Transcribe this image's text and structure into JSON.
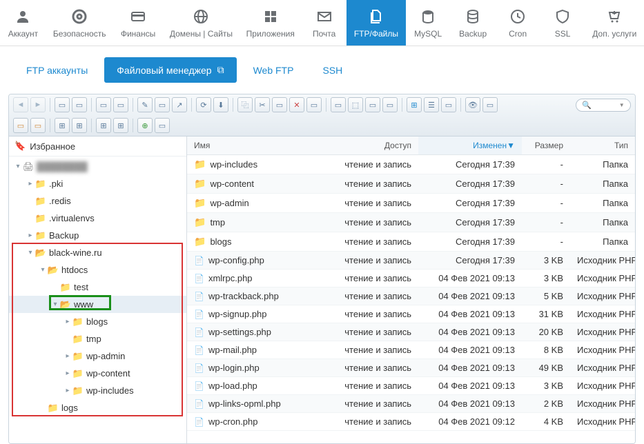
{
  "topnav": [
    {
      "label": "Аккаунт",
      "icon": "user"
    },
    {
      "label": "Безопасность",
      "icon": "lifebuoy"
    },
    {
      "label": "Финансы",
      "icon": "card"
    },
    {
      "label": "Домены | Сайты",
      "icon": "globe"
    },
    {
      "label": "Приложения",
      "icon": "apps"
    },
    {
      "label": "Почта",
      "icon": "mail"
    },
    {
      "label": "FTP/Файлы",
      "icon": "files",
      "active": true
    },
    {
      "label": "MySQL",
      "icon": "database"
    },
    {
      "label": "Backup",
      "icon": "backup"
    },
    {
      "label": "Cron",
      "icon": "clock"
    },
    {
      "label": "SSL",
      "icon": "shield"
    },
    {
      "label": "Доп. услуги",
      "icon": "cart"
    }
  ],
  "subnav": [
    {
      "label": "FTP аккаунты"
    },
    {
      "label": "Файловый менеджер",
      "active": true,
      "ext_icon": true
    },
    {
      "label": "Web FTP"
    },
    {
      "label": "SSH"
    }
  ],
  "favorites_label": "Избранное",
  "tree": [
    {
      "label": "",
      "depth": 0,
      "expander": "▾",
      "icon": "printer",
      "blur": true
    },
    {
      "label": ".pki",
      "depth": 1,
      "expander": "▸",
      "icon": "folder"
    },
    {
      "label": ".redis",
      "depth": 1,
      "expander": "",
      "icon": "folder"
    },
    {
      "label": ".virtualenvs",
      "depth": 1,
      "expander": "",
      "icon": "folder"
    },
    {
      "label": "Backup",
      "depth": 1,
      "expander": "▸",
      "icon": "folder"
    },
    {
      "label": "black-wine.ru",
      "depth": 1,
      "expander": "▾",
      "icon": "folder-open"
    },
    {
      "label": "htdocs",
      "depth": 2,
      "expander": "▾",
      "icon": "folder-open"
    },
    {
      "label": "test",
      "depth": 3,
      "expander": "",
      "icon": "folder"
    },
    {
      "label": "www",
      "depth": 3,
      "expander": "▾",
      "icon": "folder-open",
      "selected": true
    },
    {
      "label": "blogs",
      "depth": 4,
      "expander": "▸",
      "icon": "folder"
    },
    {
      "label": "tmp",
      "depth": 4,
      "expander": "",
      "icon": "folder"
    },
    {
      "label": "wp-admin",
      "depth": 4,
      "expander": "▸",
      "icon": "folder"
    },
    {
      "label": "wp-content",
      "depth": 4,
      "expander": "▸",
      "icon": "folder"
    },
    {
      "label": "wp-includes",
      "depth": 4,
      "expander": "▸",
      "icon": "folder"
    },
    {
      "label": "logs",
      "depth": 2,
      "expander": "",
      "icon": "folder"
    }
  ],
  "columns": {
    "name": "Имя",
    "access": "Доступ",
    "modified": "Изменен",
    "size": "Размер",
    "type": "Тип"
  },
  "files": [
    {
      "name": "wp-includes",
      "icon": "folder",
      "access": "чтение и запись",
      "modified": "Сегодня 17:39",
      "size": "-",
      "type": "Папка"
    },
    {
      "name": "wp-content",
      "icon": "folder",
      "access": "чтение и запись",
      "modified": "Сегодня 17:39",
      "size": "-",
      "type": "Папка"
    },
    {
      "name": "wp-admin",
      "icon": "folder",
      "access": "чтение и запись",
      "modified": "Сегодня 17:39",
      "size": "-",
      "type": "Папка"
    },
    {
      "name": "tmp",
      "icon": "folder",
      "access": "чтение и запись",
      "modified": "Сегодня 17:39",
      "size": "-",
      "type": "Папка"
    },
    {
      "name": "blogs",
      "icon": "folder",
      "access": "чтение и запись",
      "modified": "Сегодня 17:39",
      "size": "-",
      "type": "Папка"
    },
    {
      "name": "wp-config.php",
      "icon": "php",
      "access": "чтение и запись",
      "modified": "Сегодня 17:39",
      "size": "3 KB",
      "type": "Исходник PHP"
    },
    {
      "name": "xmlrpc.php",
      "icon": "php",
      "access": "чтение и запись",
      "modified": "04 Фев 2021 09:13",
      "size": "3 KB",
      "type": "Исходник PHP"
    },
    {
      "name": "wp-trackback.php",
      "icon": "php",
      "access": "чтение и запись",
      "modified": "04 Фев 2021 09:13",
      "size": "5 KB",
      "type": "Исходник PHP"
    },
    {
      "name": "wp-signup.php",
      "icon": "php",
      "access": "чтение и запись",
      "modified": "04 Фев 2021 09:13",
      "size": "31 KB",
      "type": "Исходник PHP"
    },
    {
      "name": "wp-settings.php",
      "icon": "php",
      "access": "чтение и запись",
      "modified": "04 Фев 2021 09:13",
      "size": "20 KB",
      "type": "Исходник PHP"
    },
    {
      "name": "wp-mail.php",
      "icon": "php",
      "access": "чтение и запись",
      "modified": "04 Фев 2021 09:13",
      "size": "8 KB",
      "type": "Исходник PHP"
    },
    {
      "name": "wp-login.php",
      "icon": "php",
      "access": "чтение и запись",
      "modified": "04 Фев 2021 09:13",
      "size": "49 KB",
      "type": "Исходник PHP"
    },
    {
      "name": "wp-load.php",
      "icon": "php",
      "access": "чтение и запись",
      "modified": "04 Фев 2021 09:13",
      "size": "3 KB",
      "type": "Исходник PHP"
    },
    {
      "name": "wp-links-opml.php",
      "icon": "php",
      "access": "чтение и запись",
      "modified": "04 Фев 2021 09:13",
      "size": "2 KB",
      "type": "Исходник PHP"
    },
    {
      "name": "wp-cron.php",
      "icon": "php",
      "access": "чтение и запись",
      "modified": "04 Фев 2021 09:12",
      "size": "4 KB",
      "type": "Исходник PHP"
    }
  ],
  "highlight": {
    "red": true,
    "green": true
  }
}
